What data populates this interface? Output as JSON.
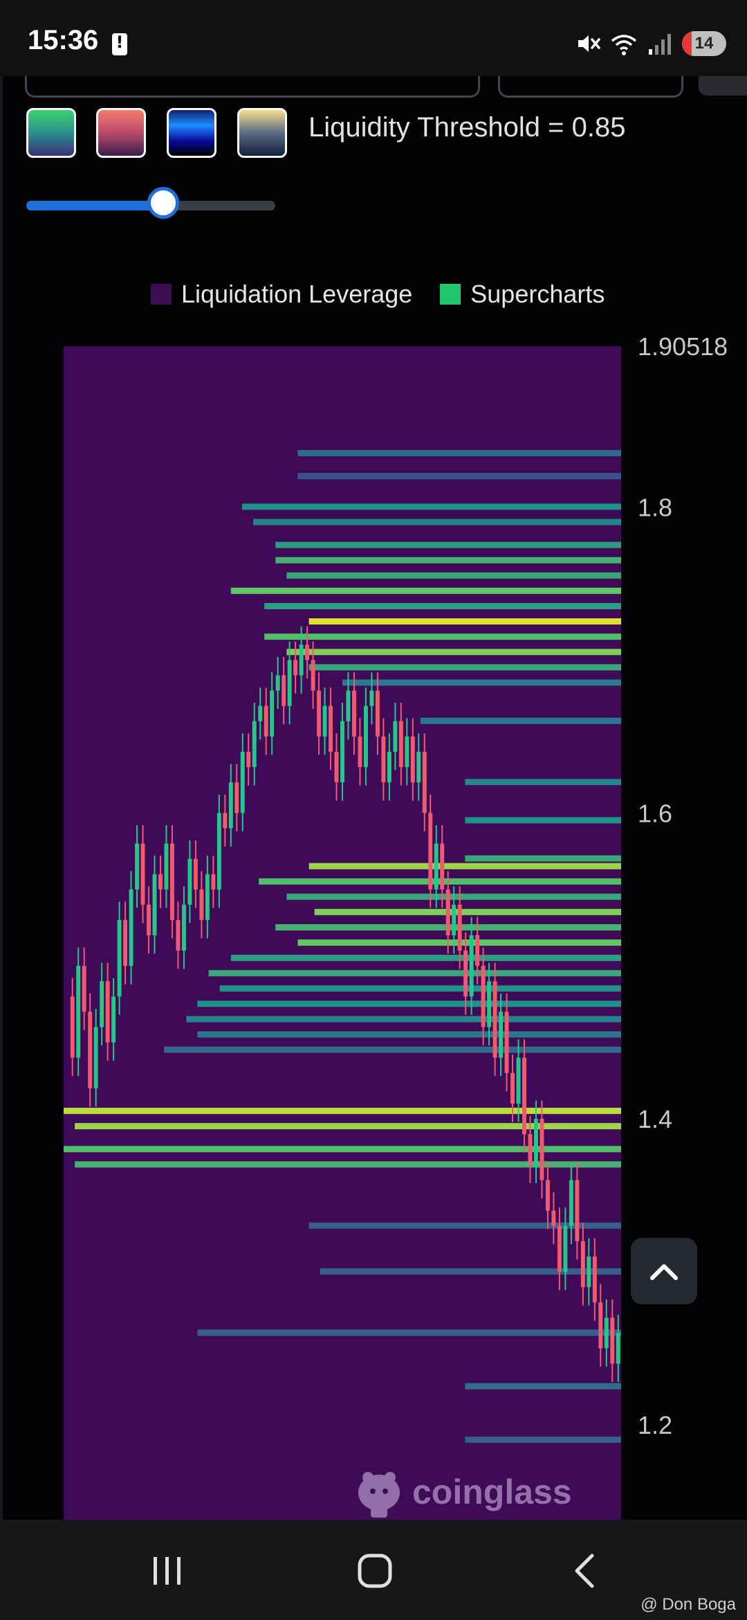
{
  "status_bar": {
    "time": "15:36",
    "battery_level": "14",
    "icons": [
      "battery-alert-icon",
      "mute-icon",
      "wifi-icon",
      "signal-icon"
    ]
  },
  "controls": {
    "swatches": [
      {
        "name": "viridis",
        "colors": [
          "#3bd16f",
          "#3c2e7a"
        ]
      },
      {
        "name": "rose",
        "colors": [
          "#f47b6c",
          "#3b1e4e"
        ]
      },
      {
        "name": "blue",
        "colors": [
          "#1f8cff",
          "#000000"
        ]
      },
      {
        "name": "cividis",
        "colors": [
          "#f7e08a",
          "#121e3d"
        ]
      }
    ],
    "threshold_label": "Liquidity Threshold = 0.85",
    "threshold_value": 0.85,
    "slider_fraction": 0.55
  },
  "legend": {
    "items": [
      {
        "label": "Liquidation Leverage",
        "color": "#3d0f52"
      },
      {
        "label": "Supercharts",
        "color": "#22c66d"
      }
    ]
  },
  "chart_data": {
    "type": "heatmap",
    "y_axis": {
      "min": 1.138,
      "max": 1.90518,
      "ticks": [
        1.90518,
        1.8,
        1.6,
        1.4,
        1.2
      ],
      "tick_labels": [
        "1.90518",
        "1.8",
        "1.6",
        "1.4",
        "1.2"
      ],
      "side": "right"
    },
    "background": "#3f0a57",
    "colorscale": [
      "#3f0a57",
      "#3b528b",
      "#21918c",
      "#5ec962",
      "#fde725"
    ],
    "price_series": [
      1.48,
      1.44,
      1.5,
      1.47,
      1.42,
      1.46,
      1.49,
      1.45,
      1.48,
      1.53,
      1.5,
      1.55,
      1.58,
      1.54,
      1.52,
      1.56,
      1.55,
      1.58,
      1.53,
      1.51,
      1.54,
      1.57,
      1.55,
      1.53,
      1.56,
      1.55,
      1.6,
      1.59,
      1.62,
      1.6,
      1.64,
      1.63,
      1.66,
      1.67,
      1.65,
      1.68,
      1.69,
      1.67,
      1.7,
      1.69,
      1.71,
      1.7,
      1.68,
      1.65,
      1.67,
      1.64,
      1.62,
      1.66,
      1.68,
      1.65,
      1.63,
      1.67,
      1.68,
      1.65,
      1.62,
      1.64,
      1.66,
      1.63,
      1.65,
      1.62,
      1.64,
      1.6,
      1.55,
      1.58,
      1.55,
      1.52,
      1.54,
      1.51,
      1.48,
      1.52,
      1.5,
      1.46,
      1.49,
      1.44,
      1.47,
      1.43,
      1.41,
      1.44,
      1.39,
      1.37,
      1.4,
      1.36,
      1.34,
      1.33,
      1.3,
      1.33,
      1.36,
      1.32,
      1.29,
      1.31,
      1.28,
      1.25,
      1.27,
      1.24,
      1.26
    ],
    "liquidity_bands": [
      {
        "price": 1.835,
        "x_start": 0.42,
        "intensity": 0.35
      },
      {
        "price": 1.82,
        "x_start": 0.42,
        "intensity": 0.25
      },
      {
        "price": 1.8,
        "x_start": 0.32,
        "intensity": 0.5
      },
      {
        "price": 1.79,
        "x_start": 0.34,
        "intensity": 0.45
      },
      {
        "price": 1.775,
        "x_start": 0.38,
        "intensity": 0.55
      },
      {
        "price": 1.765,
        "x_start": 0.38,
        "intensity": 0.65
      },
      {
        "price": 1.755,
        "x_start": 0.4,
        "intensity": 0.6
      },
      {
        "price": 1.745,
        "x_start": 0.3,
        "intensity": 0.75
      },
      {
        "price": 1.735,
        "x_start": 0.36,
        "intensity": 0.55
      },
      {
        "price": 1.725,
        "x_start": 0.44,
        "intensity": 0.95
      },
      {
        "price": 1.715,
        "x_start": 0.36,
        "intensity": 0.7
      },
      {
        "price": 1.705,
        "x_start": 0.4,
        "intensity": 0.8
      },
      {
        "price": 1.695,
        "x_start": 0.44,
        "intensity": 0.6
      },
      {
        "price": 1.685,
        "x_start": 0.5,
        "intensity": 0.4
      },
      {
        "price": 1.66,
        "x_start": 0.64,
        "intensity": 0.4
      },
      {
        "price": 1.62,
        "x_start": 0.72,
        "intensity": 0.45
      },
      {
        "price": 1.595,
        "x_start": 0.72,
        "intensity": 0.5
      },
      {
        "price": 1.57,
        "x_start": 0.72,
        "intensity": 0.6
      },
      {
        "price": 1.565,
        "x_start": 0.44,
        "intensity": 0.85
      },
      {
        "price": 1.555,
        "x_start": 0.35,
        "intensity": 0.7
      },
      {
        "price": 1.545,
        "x_start": 0.4,
        "intensity": 0.6
      },
      {
        "price": 1.535,
        "x_start": 0.45,
        "intensity": 0.8
      },
      {
        "price": 1.525,
        "x_start": 0.38,
        "intensity": 0.65
      },
      {
        "price": 1.515,
        "x_start": 0.42,
        "intensity": 0.75
      },
      {
        "price": 1.505,
        "x_start": 0.3,
        "intensity": 0.55
      },
      {
        "price": 1.495,
        "x_start": 0.26,
        "intensity": 0.6
      },
      {
        "price": 1.485,
        "x_start": 0.28,
        "intensity": 0.5
      },
      {
        "price": 1.475,
        "x_start": 0.24,
        "intensity": 0.5
      },
      {
        "price": 1.465,
        "x_start": 0.22,
        "intensity": 0.45
      },
      {
        "price": 1.455,
        "x_start": 0.24,
        "intensity": 0.4
      },
      {
        "price": 1.445,
        "x_start": 0.18,
        "intensity": 0.35
      },
      {
        "price": 1.405,
        "x_start": 0.0,
        "intensity": 0.9
      },
      {
        "price": 1.395,
        "x_start": 0.02,
        "intensity": 0.85
      },
      {
        "price": 1.38,
        "x_start": 0.0,
        "intensity": 0.7
      },
      {
        "price": 1.37,
        "x_start": 0.02,
        "intensity": 0.65
      },
      {
        "price": 1.33,
        "x_start": 0.44,
        "intensity": 0.3
      },
      {
        "price": 1.3,
        "x_start": 0.46,
        "intensity": 0.3
      },
      {
        "price": 1.26,
        "x_start": 0.24,
        "intensity": 0.3
      },
      {
        "price": 1.225,
        "x_start": 0.72,
        "intensity": 0.35
      },
      {
        "price": 1.19,
        "x_start": 0.72,
        "intensity": 0.3
      }
    ]
  },
  "watermark": {
    "text": "coinglass"
  },
  "scroll_button": {
    "icon": "chevron-up-icon"
  },
  "nav": {
    "icons": [
      "recents-icon",
      "home-icon",
      "back-icon"
    ],
    "credit": "@ Don Boga"
  }
}
